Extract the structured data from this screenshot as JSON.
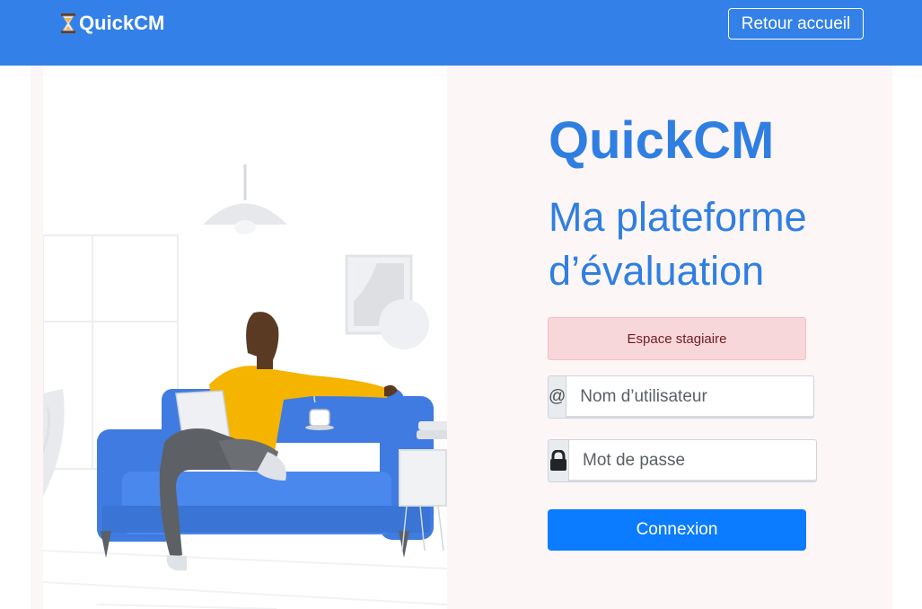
{
  "navbar": {
    "brand": "QuickCM",
    "brand_icon": "hourglass-icon",
    "back_button": "Retour accueil",
    "background": "#3381e8"
  },
  "hero": {
    "title": "QuickCM",
    "subtitle": "Ma plateforme d’évaluation",
    "accent_color": "#2f7fe3"
  },
  "login": {
    "alert": "Espace stagiaire",
    "username_icon": "@",
    "username_placeholder": "Nom d’utilisateur",
    "password_icon": "lock-icon",
    "password_placeholder": "Mot de passe",
    "submit": "Connexion",
    "submit_color": "#0b7bff"
  },
  "illustration": {
    "description_icon": "man-on-sofa-with-laptop-illustration"
  }
}
